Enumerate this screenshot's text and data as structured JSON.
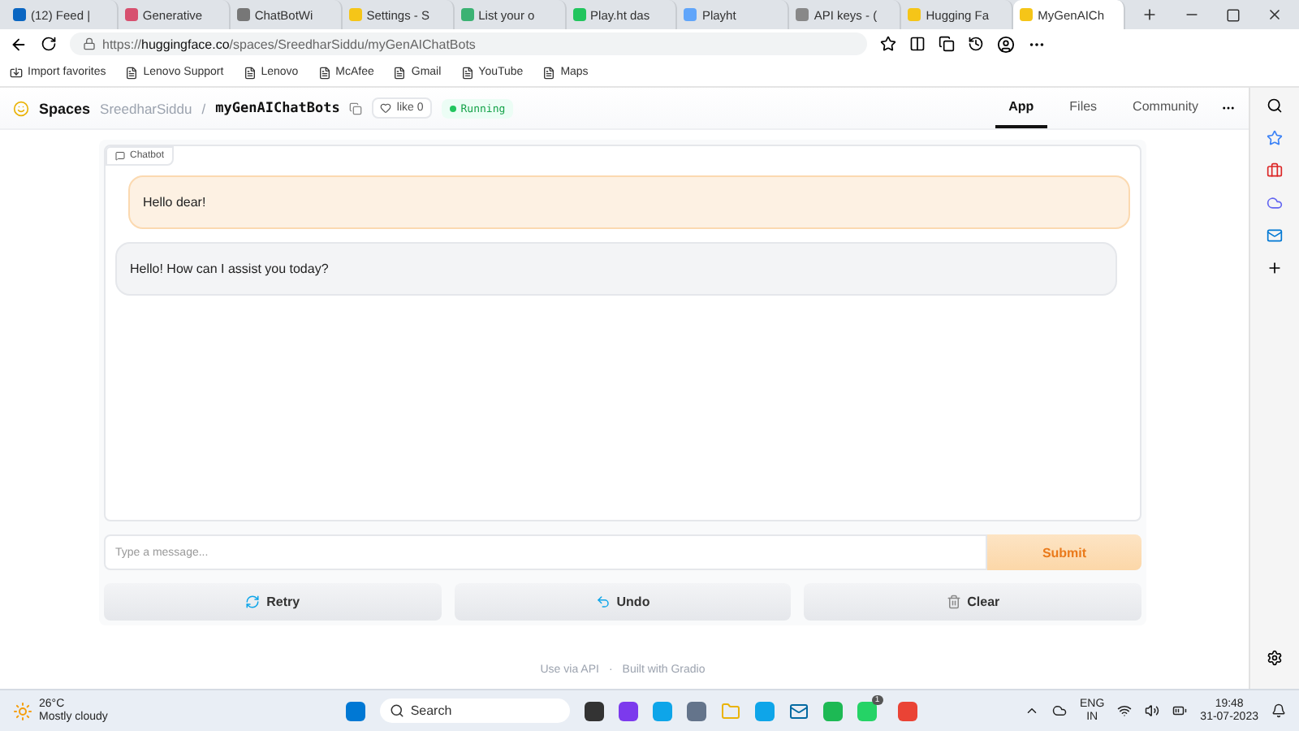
{
  "browser": {
    "tabs": [
      {
        "label": "(12) Feed |",
        "selected": false
      },
      {
        "label": "Generative",
        "selected": false
      },
      {
        "label": "ChatBotWi",
        "selected": false
      },
      {
        "label": "Settings - S",
        "selected": false
      },
      {
        "label": "List your o",
        "selected": false
      },
      {
        "label": "Play.ht das",
        "selected": false
      },
      {
        "label": "Playht",
        "selected": false
      },
      {
        "label": "API keys - (",
        "selected": false
      },
      {
        "label": "Hugging Fa",
        "selected": false
      },
      {
        "label": "MyGenAICh",
        "selected": true
      }
    ],
    "url_prefix": "https://",
    "url_host": "huggingface.co",
    "url_path": "/spaces/SreedharSiddu/myGenAIChatBots",
    "bookmarks": [
      "Import favorites",
      "Lenovo Support",
      "Lenovo",
      "McAfee",
      "Gmail",
      "YouTube",
      "Maps"
    ]
  },
  "space": {
    "brand": "Spaces",
    "owner": "SreedharSiddu",
    "separator": "/",
    "name": "myGenAIChatBots",
    "like_label": "like",
    "like_count": "0",
    "status": "Running",
    "nav": [
      {
        "label": "App",
        "selected": true
      },
      {
        "label": "Files",
        "selected": false
      },
      {
        "label": "Community",
        "selected": false
      }
    ]
  },
  "chatbot": {
    "label": "Chatbot",
    "messages": [
      {
        "kind": "user",
        "text": "Hello dear!"
      },
      {
        "kind": "bot",
        "text": "Hello! How can I assist you today?"
      }
    ],
    "input": {
      "placeholder": "Type a message..."
    },
    "submit": "Submit",
    "actions": [
      {
        "kind": "retry",
        "label": "Retry"
      },
      {
        "kind": "undo",
        "label": "Undo"
      },
      {
        "kind": "clear",
        "label": "Clear"
      }
    ]
  },
  "footer": {
    "api": "Use via API",
    "separator": "·",
    "built": "Built with Gradio"
  },
  "taskbar": {
    "temperature": "26°C",
    "weather": "Mostly cloudy",
    "search": "Search",
    "lang": "ENG",
    "region": "IN",
    "time": "19:48",
    "date": "31-07-2023",
    "badge": "1"
  }
}
